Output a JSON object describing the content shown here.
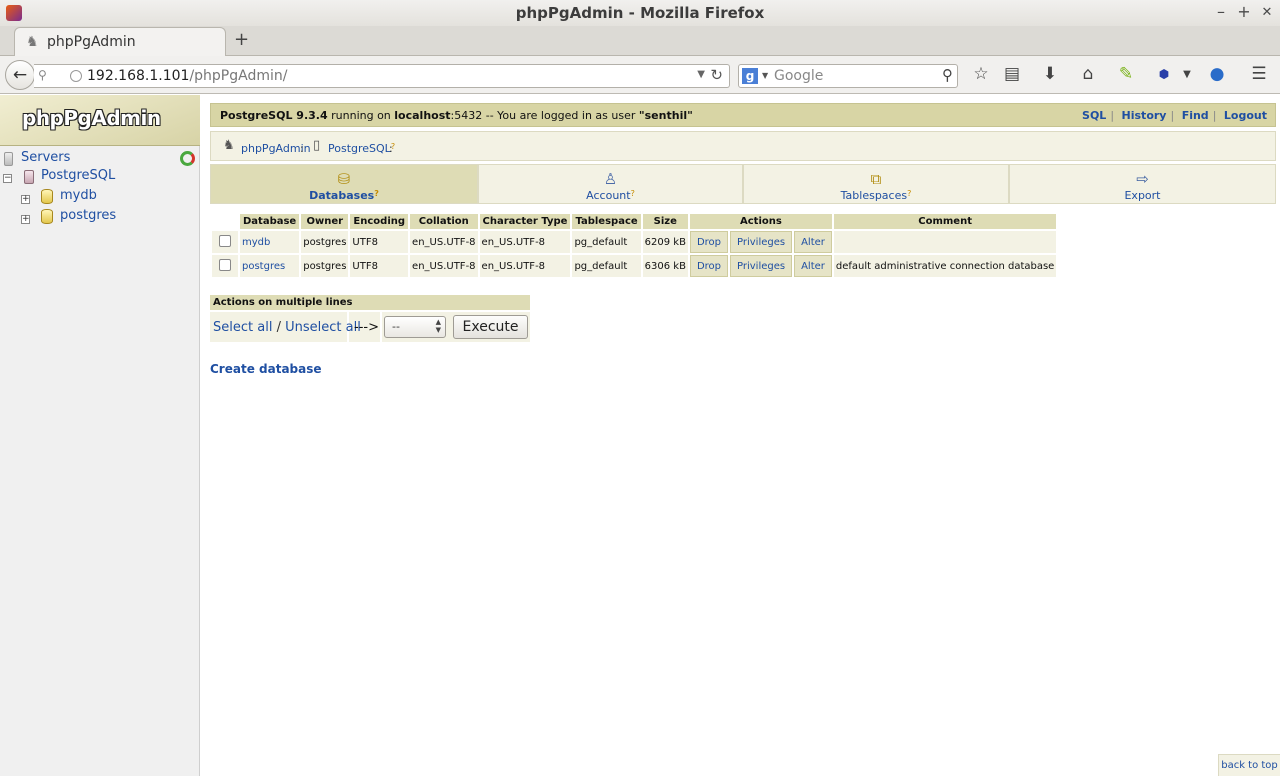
{
  "window": {
    "title": "phpPgAdmin - Mozilla Firefox",
    "controls": {
      "minimize": "–",
      "maximize": "+",
      "close": "✕"
    }
  },
  "browser": {
    "tab_title": "phpPgAdmin",
    "new_tab": "+",
    "url_host": "192.168.1.101",
    "url_path": "/phpPgAdmin/",
    "search_engine": "Google",
    "search_engine_letter": "g",
    "toolbar_icons": [
      "star-icon",
      "reading-list-icon",
      "download-icon",
      "home-icon",
      "feather-icon",
      "abp-icon",
      "profile-icon",
      "menu-icon"
    ]
  },
  "sidebar": {
    "logo": "phpPgAdmin",
    "tree": {
      "root": "Servers",
      "server": {
        "label": "PostgreSQL",
        "toggle": "−"
      },
      "databases": [
        {
          "label": "mydb",
          "toggle": "+"
        },
        {
          "label": "postgres",
          "toggle": "+"
        }
      ]
    }
  },
  "topbar": {
    "server_version": "PostgreSQL 9.3.4",
    "running_on": "running on",
    "host": "localhost",
    "port": ":5432",
    "logged_in": "-- You are logged in as user",
    "user": "\"senthil\"",
    "links": [
      "SQL",
      "History",
      "Find",
      "Logout"
    ]
  },
  "trail": {
    "app": "phpPgAdmin",
    "server": "PostgreSQL",
    "help": "?",
    "sep": ":"
  },
  "tabs": [
    {
      "label": "Databases",
      "help": "?",
      "icon": "database-icon",
      "active": true
    },
    {
      "label": "Account",
      "help": "?",
      "icon": "user-icon",
      "active": false
    },
    {
      "label": "Tablespaces",
      "help": "?",
      "icon": "tablespaces-icon",
      "active": false
    },
    {
      "label": "Export",
      "help": "",
      "icon": "export-icon",
      "active": false
    }
  ],
  "table": {
    "headers": [
      "Database",
      "Owner",
      "Encoding",
      "Collation",
      "Character Type",
      "Tablespace",
      "Size",
      "Actions",
      "Comment"
    ],
    "rows": [
      {
        "database": "mydb",
        "owner": "postgres",
        "encoding": "UTF8",
        "collation": "en_US.UTF-8",
        "ctype": "en_US.UTF-8",
        "tablespace": "pg_default",
        "size": "6209 kB",
        "drop": "Drop",
        "privileges": "Privileges",
        "alter": "Alter",
        "comment": ""
      },
      {
        "database": "postgres",
        "owner": "postgres",
        "encoding": "UTF8",
        "collation": "en_US.UTF-8",
        "ctype": "en_US.UTF-8",
        "tablespace": "pg_default",
        "size": "6306 kB",
        "drop": "Drop",
        "privileges": "Privileges",
        "alter": "Alter",
        "comment": "default administrative connection database"
      }
    ]
  },
  "multi": {
    "heading": "Actions on multiple lines",
    "select_all": "Select all",
    "slash": "/",
    "unselect_all": "Unselect all",
    "arrow": "--->",
    "select_value": "--",
    "execute": "Execute"
  },
  "create_database": "Create database",
  "back_to_top": "back to top"
}
